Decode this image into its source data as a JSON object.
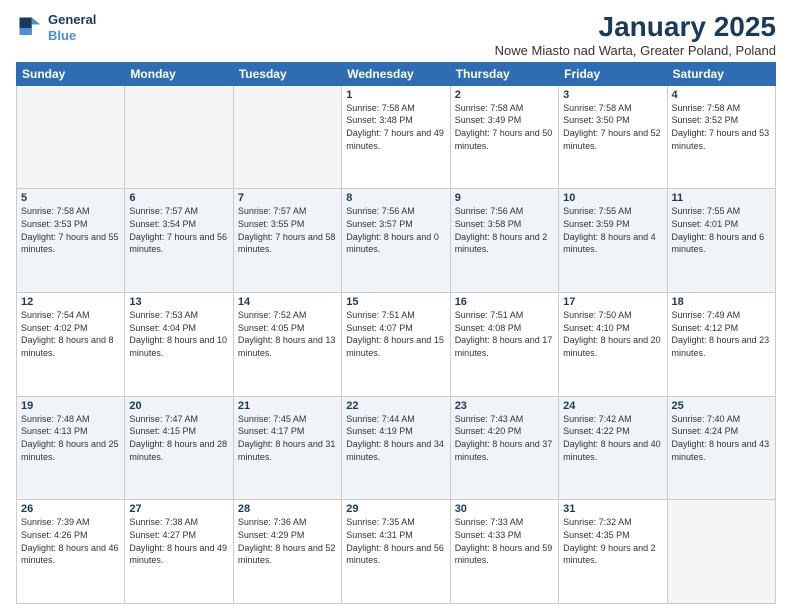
{
  "logo": {
    "line1": "General",
    "line2": "Blue"
  },
  "title": "January 2025",
  "subtitle": "Nowe Miasto nad Warta, Greater Poland, Poland",
  "days_of_week": [
    "Sunday",
    "Monday",
    "Tuesday",
    "Wednesday",
    "Thursday",
    "Friday",
    "Saturday"
  ],
  "weeks": [
    [
      {
        "day": "",
        "empty": true
      },
      {
        "day": "",
        "empty": true
      },
      {
        "day": "",
        "empty": true
      },
      {
        "day": "1",
        "sunrise": "7:58 AM",
        "sunset": "3:48 PM",
        "daylight": "7 hours and 49 minutes."
      },
      {
        "day": "2",
        "sunrise": "7:58 AM",
        "sunset": "3:49 PM",
        "daylight": "7 hours and 50 minutes."
      },
      {
        "day": "3",
        "sunrise": "7:58 AM",
        "sunset": "3:50 PM",
        "daylight": "7 hours and 52 minutes."
      },
      {
        "day": "4",
        "sunrise": "7:58 AM",
        "sunset": "3:52 PM",
        "daylight": "7 hours and 53 minutes."
      }
    ],
    [
      {
        "day": "5",
        "sunrise": "7:58 AM",
        "sunset": "3:53 PM",
        "daylight": "7 hours and 55 minutes."
      },
      {
        "day": "6",
        "sunrise": "7:57 AM",
        "sunset": "3:54 PM",
        "daylight": "7 hours and 56 minutes."
      },
      {
        "day": "7",
        "sunrise": "7:57 AM",
        "sunset": "3:55 PM",
        "daylight": "7 hours and 58 minutes."
      },
      {
        "day": "8",
        "sunrise": "7:56 AM",
        "sunset": "3:57 PM",
        "daylight": "8 hours and 0 minutes."
      },
      {
        "day": "9",
        "sunrise": "7:56 AM",
        "sunset": "3:58 PM",
        "daylight": "8 hours and 2 minutes."
      },
      {
        "day": "10",
        "sunrise": "7:55 AM",
        "sunset": "3:59 PM",
        "daylight": "8 hours and 4 minutes."
      },
      {
        "day": "11",
        "sunrise": "7:55 AM",
        "sunset": "4:01 PM",
        "daylight": "8 hours and 6 minutes."
      }
    ],
    [
      {
        "day": "12",
        "sunrise": "7:54 AM",
        "sunset": "4:02 PM",
        "daylight": "8 hours and 8 minutes."
      },
      {
        "day": "13",
        "sunrise": "7:53 AM",
        "sunset": "4:04 PM",
        "daylight": "8 hours and 10 minutes."
      },
      {
        "day": "14",
        "sunrise": "7:52 AM",
        "sunset": "4:05 PM",
        "daylight": "8 hours and 13 minutes."
      },
      {
        "day": "15",
        "sunrise": "7:51 AM",
        "sunset": "4:07 PM",
        "daylight": "8 hours and 15 minutes."
      },
      {
        "day": "16",
        "sunrise": "7:51 AM",
        "sunset": "4:08 PM",
        "daylight": "8 hours and 17 minutes."
      },
      {
        "day": "17",
        "sunrise": "7:50 AM",
        "sunset": "4:10 PM",
        "daylight": "8 hours and 20 minutes."
      },
      {
        "day": "18",
        "sunrise": "7:49 AM",
        "sunset": "4:12 PM",
        "daylight": "8 hours and 23 minutes."
      }
    ],
    [
      {
        "day": "19",
        "sunrise": "7:48 AM",
        "sunset": "4:13 PM",
        "daylight": "8 hours and 25 minutes."
      },
      {
        "day": "20",
        "sunrise": "7:47 AM",
        "sunset": "4:15 PM",
        "daylight": "8 hours and 28 minutes."
      },
      {
        "day": "21",
        "sunrise": "7:45 AM",
        "sunset": "4:17 PM",
        "daylight": "8 hours and 31 minutes."
      },
      {
        "day": "22",
        "sunrise": "7:44 AM",
        "sunset": "4:19 PM",
        "daylight": "8 hours and 34 minutes."
      },
      {
        "day": "23",
        "sunrise": "7:43 AM",
        "sunset": "4:20 PM",
        "daylight": "8 hours and 37 minutes."
      },
      {
        "day": "24",
        "sunrise": "7:42 AM",
        "sunset": "4:22 PM",
        "daylight": "8 hours and 40 minutes."
      },
      {
        "day": "25",
        "sunrise": "7:40 AM",
        "sunset": "4:24 PM",
        "daylight": "8 hours and 43 minutes."
      }
    ],
    [
      {
        "day": "26",
        "sunrise": "7:39 AM",
        "sunset": "4:26 PM",
        "daylight": "8 hours and 46 minutes."
      },
      {
        "day": "27",
        "sunrise": "7:38 AM",
        "sunset": "4:27 PM",
        "daylight": "8 hours and 49 minutes."
      },
      {
        "day": "28",
        "sunrise": "7:36 AM",
        "sunset": "4:29 PM",
        "daylight": "8 hours and 52 minutes."
      },
      {
        "day": "29",
        "sunrise": "7:35 AM",
        "sunset": "4:31 PM",
        "daylight": "8 hours and 56 minutes."
      },
      {
        "day": "30",
        "sunrise": "7:33 AM",
        "sunset": "4:33 PM",
        "daylight": "8 hours and 59 minutes."
      },
      {
        "day": "31",
        "sunrise": "7:32 AM",
        "sunset": "4:35 PM",
        "daylight": "9 hours and 2 minutes."
      },
      {
        "day": "",
        "empty": true
      }
    ]
  ]
}
